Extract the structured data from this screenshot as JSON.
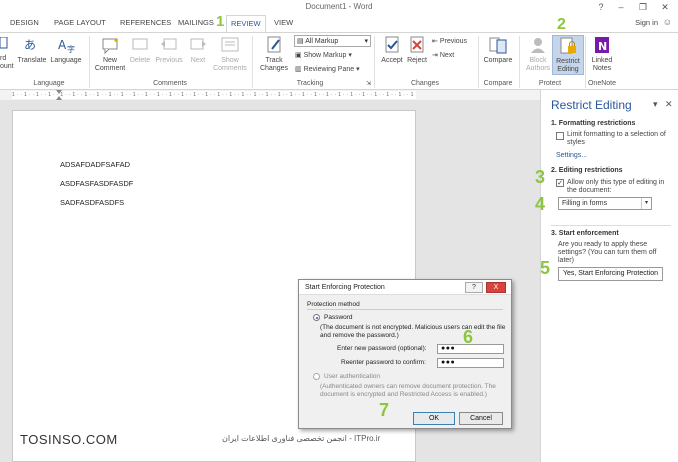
{
  "window": {
    "title": "Document1 - Word",
    "help": "?",
    "minimize": "–",
    "restore": "❐",
    "close": "✕"
  },
  "tabs": [
    "DESIGN",
    "PAGE LAYOUT",
    "REFERENCES",
    "MAILINGS",
    "REVIEW",
    "VIEW"
  ],
  "active_tab": "REVIEW",
  "signin": "Sign in",
  "ribbon": {
    "edge_labels": [
      "rd",
      "ount"
    ],
    "translate": "Translate",
    "language": "Language",
    "new_comment": "New Comment",
    "delete": "Delete",
    "previous": "Previous",
    "next": "Next",
    "show_comments": "Show Comments",
    "track_changes": "Track Changes",
    "all_markup": "All Markup",
    "show_markup": "Show Markup",
    "reviewing_pane": "Reviewing Pane",
    "accept": "Accept",
    "reject": "Reject",
    "changes_previous": "Previous",
    "changes_next": "Next",
    "compare": "Compare",
    "block_authors": "Block Authors",
    "restrict_editing": "Restrict Editing",
    "linked_notes": "Linked Notes",
    "groups": {
      "language": "Language",
      "comments": "Comments",
      "tracking": "Tracking",
      "changes": "Changes",
      "compare": "Compare",
      "protect": "Protect",
      "onenote": "OneNote"
    }
  },
  "ruler": "1 · · 1 · · 1 · · 1 · · 1 · · 1 · · 1 · · 1 · · 1 · · 1 · · 1 · · 1 · · 1 · · 1 · · 1 · · 1 · · 1 · · 1 · · 1 · · 1 · · 1 · · 1 · · 1 · · 1 · · 1 · · 1 · · 1 · · 1 · · 1 · · 1 · · 1 · · 1 · · 1 · · 1 · · 1 · · 1 · · 91",
  "document": {
    "paragraphs": [
      "ADSAFDADFSAFAD",
      "ASDFASFASDFASDF",
      "SADFASDFASDFS"
    ]
  },
  "pane": {
    "title": "Restrict Editing",
    "menu_arrow": "▾",
    "close": "✕",
    "sec1_title": "1. Formatting restrictions",
    "sec1_option": "Limit formatting to a selection of styles",
    "sec1_link": "Settings...",
    "sec2_title": "2. Editing restrictions",
    "sec2_option": "Allow only this type of editing in the document:",
    "sec2_select": "Filling in forms",
    "sec3_title": "3. Start enforcement",
    "sec3_text": "Are you ready to apply these settings? (You can turn them off later)",
    "sec3_button": "Yes, Start Enforcing Protection"
  },
  "dialog": {
    "title": "Start Enforcing Protection",
    "help": "?",
    "close": "X",
    "method_label": "Protection method",
    "password_label": "Password",
    "password_note": "(The document is not encrypted. Malicious users can edit the file and remove the password.)",
    "enter_label": "Enter new password (optional):",
    "enter_value": "●●●",
    "reenter_label": "Reenter password to confirm:",
    "reenter_value": "●●●",
    "userauth_label": "User authentication",
    "userauth_note": "(Authenticated owners can remove document protection. The document is encrypted and Restricted Access is enabled.)",
    "ok": "OK",
    "cancel": "Cancel"
  },
  "step_numbers": [
    "1",
    "2",
    "3",
    "4",
    "5",
    "6",
    "7"
  ],
  "watermark": {
    "left": "TOSINSO.COM",
    "right": "ITPro.ir - انجمن تخصصی فناوری اطلاعات ایران"
  },
  "colors": {
    "accent": "#2b579a",
    "step_green": "#8cc63e",
    "selected_button": "#c5d5ea",
    "close_red": "#d9443a"
  }
}
